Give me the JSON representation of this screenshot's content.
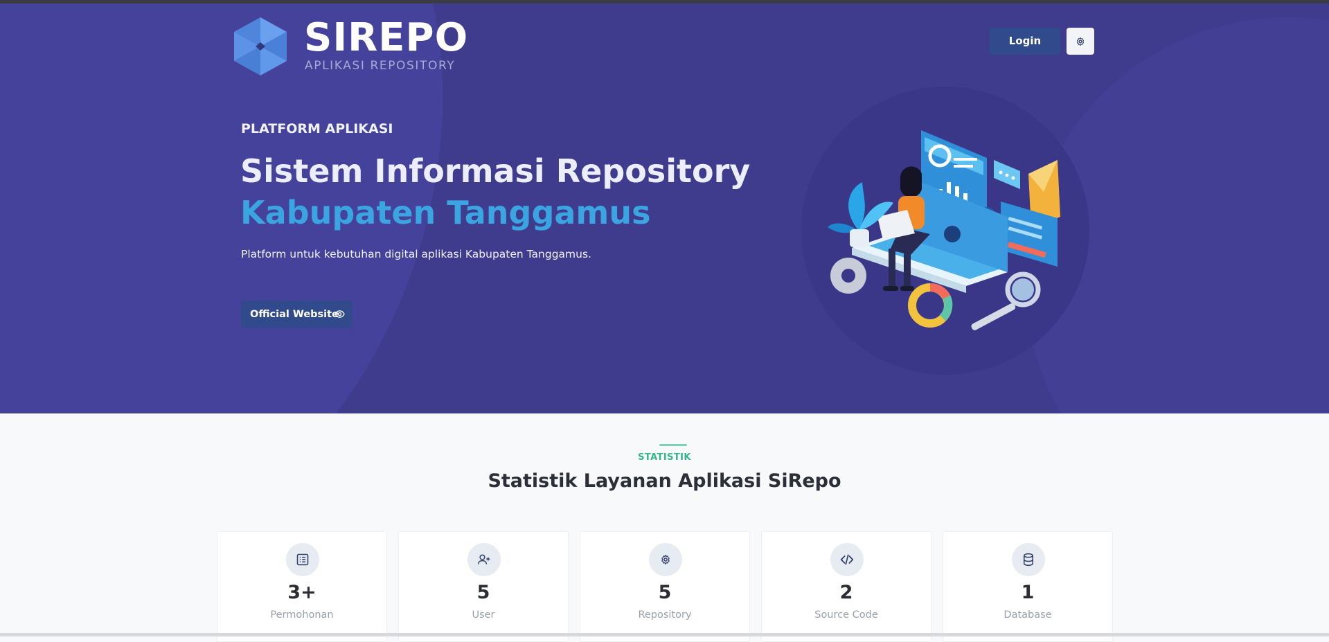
{
  "brand": {
    "name": "SIREPO",
    "tagline": "APLIKASI REPOSITORY",
    "logo_icon": "hexagon-cube-logo"
  },
  "header": {
    "login_label": "Login",
    "settings_icon": "gear-icon"
  },
  "hero": {
    "kicker": "PLATFORM APLIKASI",
    "headline_line1": "Sistem Informasi Repository",
    "headline_line2": "Kabupaten Tanggamus",
    "subtitle": "Platform untuk kebutuhan digital aplikasi Kabupaten Tanggamus.",
    "cta_label": "Official Website",
    "cta_icon": "eye-icon"
  },
  "stats": {
    "kicker": "STATISTIK",
    "title": "Statistik Layanan Aplikasi SiRepo",
    "cards": [
      {
        "value": "3+",
        "label": "Permohonan",
        "icon": "list-icon"
      },
      {
        "value": "5",
        "label": "User",
        "icon": "user-plus-icon"
      },
      {
        "value": "5",
        "label": "Repository",
        "icon": "gear-icon"
      },
      {
        "value": "2",
        "label": "Source Code",
        "icon": "code-icon"
      },
      {
        "value": "1",
        "label": "Database",
        "icon": "database-icon"
      }
    ]
  },
  "colors": {
    "hero_bg": "#3f3c8e",
    "accent_blue": "#3aa5e0",
    "button": "#314a8c",
    "stats_accent": "#34b58a"
  }
}
